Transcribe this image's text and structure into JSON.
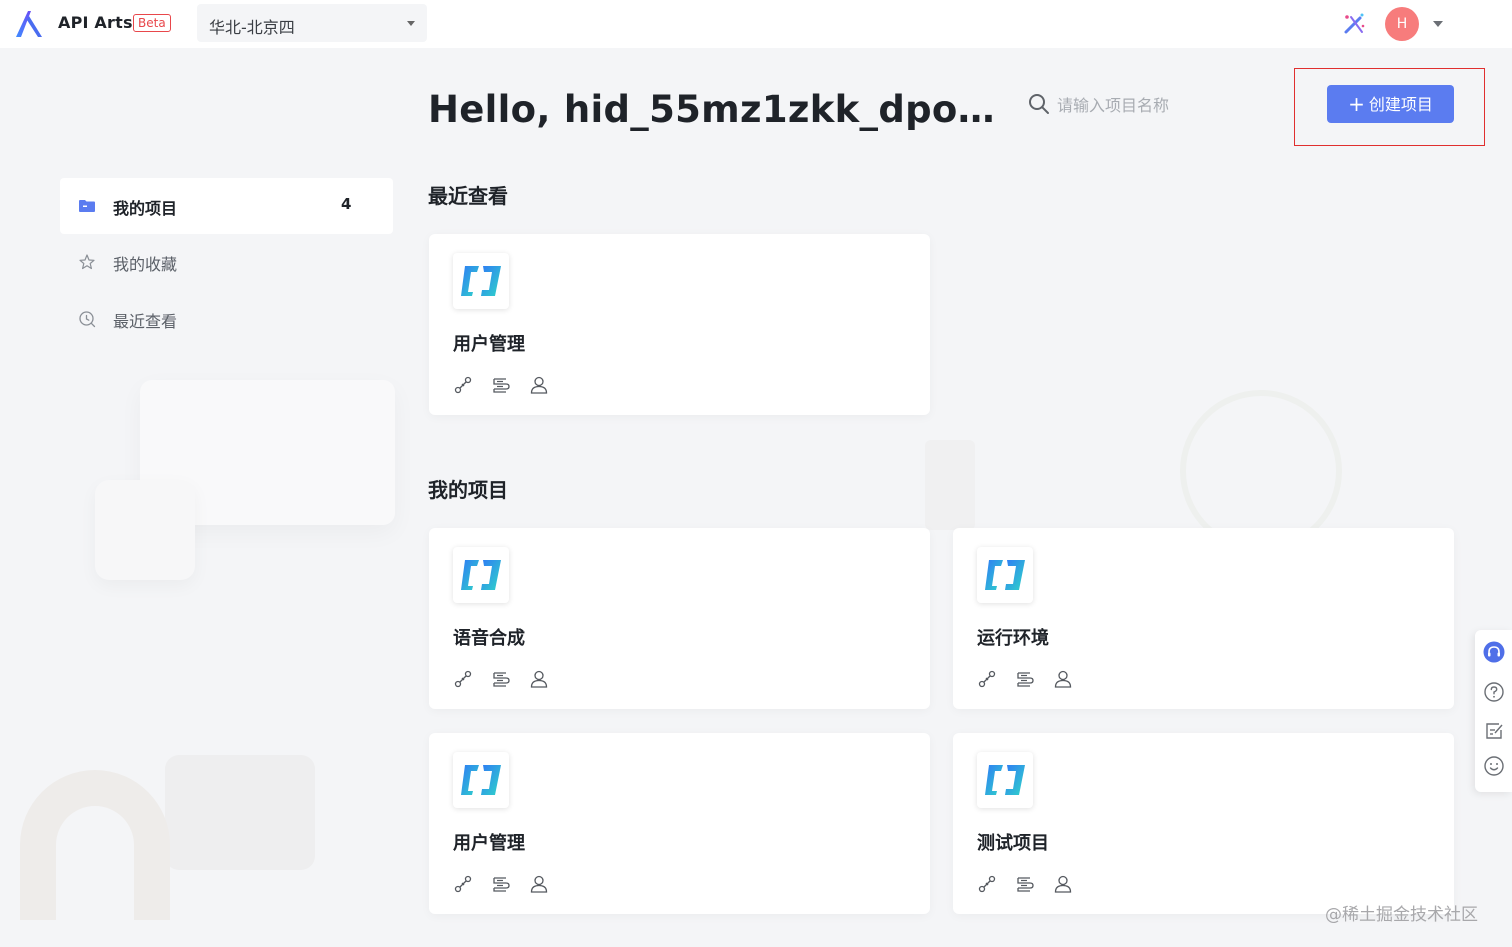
{
  "topbar": {
    "app_name": "API Arts",
    "badge": "Beta",
    "region": "华北-北京四",
    "user_initial": "H"
  },
  "sidebar": {
    "items": [
      {
        "label": "我的项目",
        "count": "4",
        "icon": "folder-icon",
        "active": true
      },
      {
        "label": "我的收藏",
        "icon": "star-icon",
        "active": false
      },
      {
        "label": "最近查看",
        "icon": "recent-icon",
        "active": false
      }
    ]
  },
  "header": {
    "greeting": "Hello, hid_55mz1zkk_dpo…",
    "search_placeholder": "请输入项目名称",
    "create_label": "创建项目"
  },
  "recent": {
    "title": "最近查看",
    "cards": [
      {
        "name": "用户管理"
      }
    ]
  },
  "projects": {
    "title": "我的项目",
    "cards": [
      {
        "name": "语音合成"
      },
      {
        "name": "运行环境"
      },
      {
        "name": "用户管理"
      },
      {
        "name": "测试项目"
      }
    ]
  },
  "card_icons": [
    "api-icon",
    "flow-icon",
    "member-icon"
  ],
  "right_toolbar": [
    "headset-icon",
    "help-icon",
    "feedback-icon",
    "smile-icon"
  ],
  "watermark": "@稀土掘金技术社区",
  "colors": {
    "primary": "#5b7cf0",
    "beta": "#e8474b",
    "avatar": "#f77c7c",
    "highlight_border": "#e02f2f"
  }
}
